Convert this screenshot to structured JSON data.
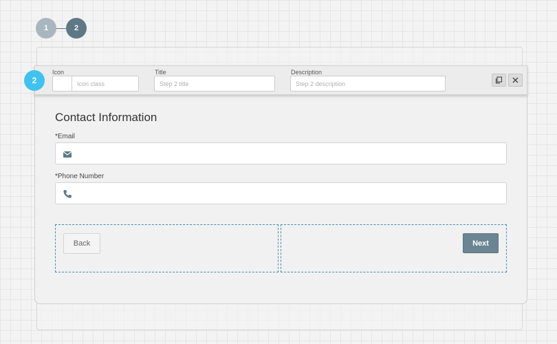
{
  "stepper": {
    "steps": [
      {
        "number": "1",
        "state": "inactive"
      },
      {
        "number": "2",
        "state": "active"
      }
    ]
  },
  "editor": {
    "badge": "2",
    "icon_label": "Icon",
    "icon_placeholder": "Icon class",
    "title_label": "Title",
    "title_placeholder": "Step 2 title",
    "description_label": "Description",
    "description_placeholder": "Step 2 description",
    "copy_icon": "copy-icon",
    "close_icon": "close-icon"
  },
  "form": {
    "heading": "Contact Information",
    "email_label": "*Email",
    "email_value": "",
    "email_icon": "envelope-icon",
    "phone_label": "*Phone Number",
    "phone_value": "",
    "phone_icon": "phone-icon"
  },
  "navigation": {
    "back_label": "Back",
    "next_label": "Next"
  },
  "colors": {
    "accent": "#3fc3ee",
    "step_active": "#5e7885",
    "step_inactive": "#a8b7bf",
    "next_button": "#6b8692",
    "column_outline": "#3d8fb5"
  }
}
